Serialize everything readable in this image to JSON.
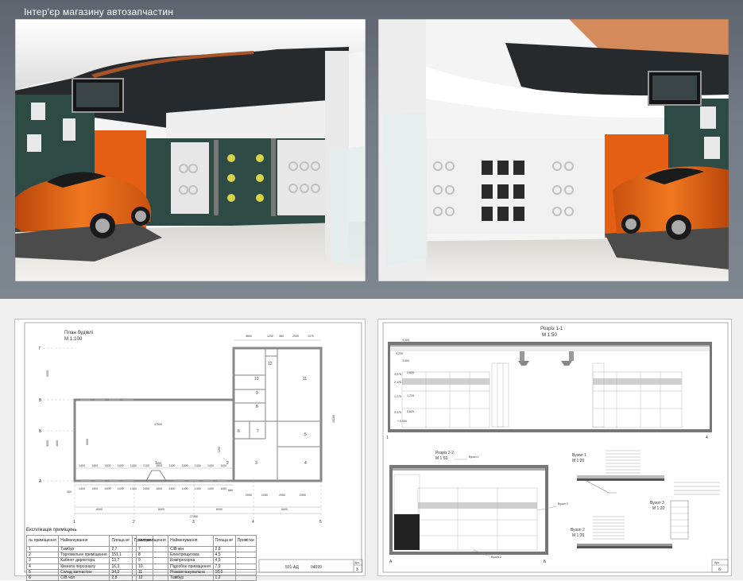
{
  "page": {
    "title": "Інтер'єр магазину автозапчастин"
  },
  "colors": {
    "wall_dark": "#2f4a46",
    "accent_orange": "#e06a1e",
    "floor": "#e8e6e1",
    "ceiling": "#f3f3f3",
    "car": "#e86512",
    "background_top": "#737b86"
  },
  "sheet3": {
    "plan_title": "План будівлі",
    "plan_scale": "М 1:100",
    "grid_letters": [
      "А",
      "Б",
      "В",
      "Г"
    ],
    "grid_numbers": [
      "1",
      "2",
      "3",
      "4",
      "5"
    ],
    "top_dims": [
      "3600",
      "1200",
      "960",
      "2000",
      "1070"
    ],
    "left_dims": [
      "6000",
      "9000",
      "4800",
      "8000"
    ],
    "right_dim": "15280",
    "inner_dims": [
      "17600",
      "9000",
      "7200",
      "4800"
    ],
    "window_dims": [
      "1400",
      "1400",
      "1400",
      "1400",
      "1400",
      "2100",
      "1500",
      "2100",
      "1400",
      "1400",
      "1400",
      "1400"
    ],
    "window_dims_bottom": [
      "1400",
      "1400",
      "1400",
      "1400",
      "1400",
      "2450",
      "1500",
      "2450",
      "1400",
      "1400",
      "1400",
      "1400"
    ],
    "bottom_dims": [
      "6000",
      "6000",
      "6000",
      "6000",
      "6000"
    ],
    "total_dim": "27380",
    "bottom_right_dims": [
      "2050",
      "2050",
      "2050",
      "2550"
    ],
    "small_dims": [
      "350",
      "680",
      "400",
      "400",
      "1800"
    ],
    "room_numbers": [
      "1",
      "2",
      "3",
      "4",
      "5",
      "6",
      "7",
      "8",
      "9",
      "10",
      "11",
      "12"
    ],
    "expl_title": "Експлікація приміщень",
    "expl_headers": [
      "№ приміщення",
      "Найменування",
      "Площа м²",
      "Примітки"
    ],
    "rooms_left": [
      {
        "n": "1",
        "name": "Тамбур",
        "area": "2,7"
      },
      {
        "n": "2",
        "name": "Торговельне приміщення",
        "area": "151,1"
      },
      {
        "n": "3",
        "name": "Кабінет директора",
        "area": "13,7"
      },
      {
        "n": "4",
        "name": "Кімната персоналу",
        "area": "16,3"
      },
      {
        "n": "5",
        "name": "Склад запчастин",
        "area": "34,3"
      },
      {
        "n": "6",
        "name": "С/В чол",
        "area": "2,8"
      }
    ],
    "rooms_right": [
      {
        "n": "7",
        "name": "С/В жін",
        "area": "2,8"
      },
      {
        "n": "8",
        "name": "Електрощитова",
        "area": "4,5"
      },
      {
        "n": "9",
        "name": "Компресорна",
        "area": "4,5"
      },
      {
        "n": "10",
        "name": "Підсобне приміщення",
        "area": "7,9"
      },
      {
        "n": "11",
        "name": "Розвантажувальна",
        "area": "10,0"
      },
      {
        "n": "12",
        "name": "Тамбур",
        "area": "1,2"
      }
    ],
    "stamp_code": "501-АД",
    "stamp_num": "04099",
    "sheet_label": "Арк.",
    "sheet_number": "3"
  },
  "sheet6": {
    "section11_title": "Розріз 1-1",
    "section11_scale": "М 1:50",
    "section11_levels": [
      "4,300",
      "4,200",
      "3,500",
      "3,075",
      "2,175",
      "1,275",
      "0,375",
      "+-0,000"
    ],
    "section11_levels_r": [
      "2,625",
      "1,725",
      "0,825"
    ],
    "section11_axes": [
      "1",
      "4"
    ],
    "section22_title": "Розріз 2-2",
    "section22_scale": "М 1:50",
    "section22_axes": [
      "А",
      "Б"
    ],
    "node1_title": "Вузол 1",
    "node1_scale": "М 1:20",
    "node2_title": "Вузол 2",
    "node2_scale": "М 1:20",
    "node3_title": "Вузол 3",
    "node3_scale": "М 1:20",
    "callouts": [
      "Вузол 1",
      "Вузол 3",
      "Вузол 2"
    ],
    "sheet_label": "Арк.",
    "sheet_number": "6"
  }
}
